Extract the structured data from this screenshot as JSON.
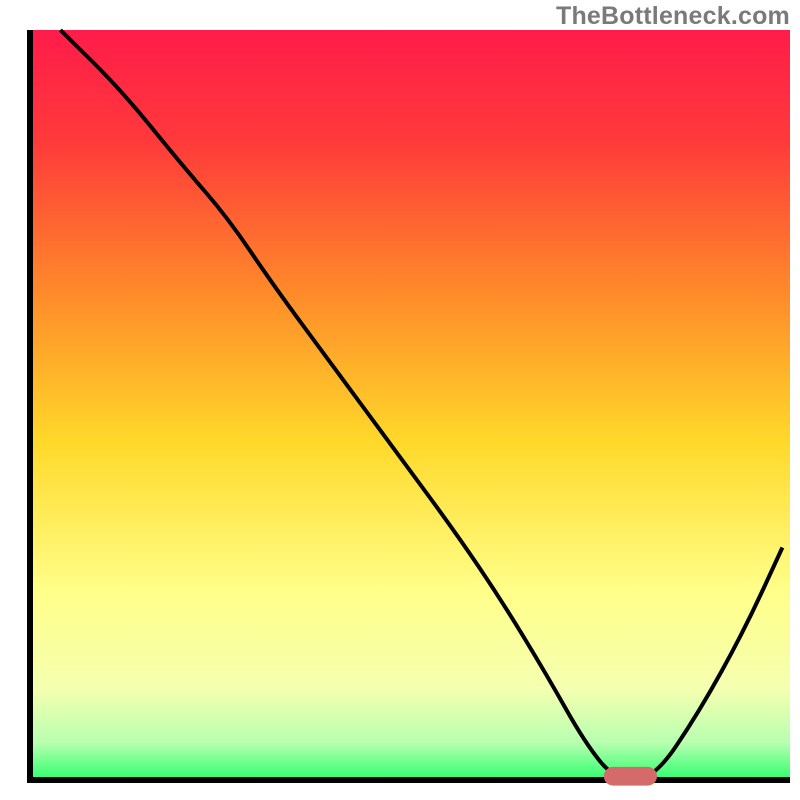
{
  "watermark": "TheBottleneck.com",
  "colors": {
    "gradient_top": "#ff1c4a",
    "gradient_mid1": "#ff8a2a",
    "gradient_mid2": "#ffd92a",
    "gradient_mid3": "#ffff8a",
    "gradient_bottom": "#2dff6e",
    "axis": "#000000",
    "curve": "#000000",
    "marker": "#d46a6a"
  },
  "chart_data": {
    "type": "line",
    "title": "",
    "xlabel": "",
    "ylabel": "",
    "xlim": [
      0,
      100
    ],
    "ylim": [
      0,
      100
    ],
    "x": [
      4,
      12,
      20,
      26,
      32,
      40,
      48,
      56,
      62,
      68,
      73,
      77,
      82,
      88,
      94,
      99
    ],
    "values": [
      100,
      92,
      82,
      75,
      66,
      55,
      44,
      33,
      24,
      14,
      5,
      0,
      0,
      9,
      20,
      31
    ],
    "marker": {
      "x_center": 79,
      "y": 0.5,
      "width": 7,
      "height": 2.5
    }
  }
}
